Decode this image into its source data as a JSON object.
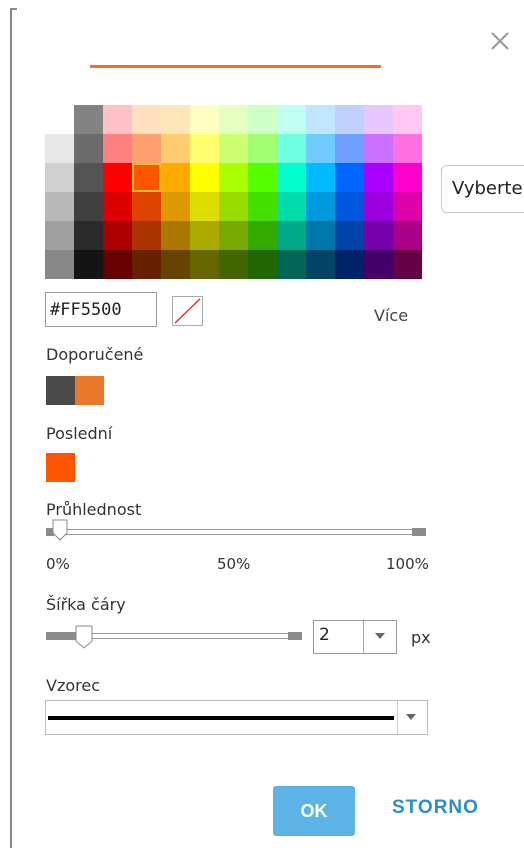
{
  "dialog": {
    "close_icon": "close-icon",
    "preview_line_color": "#f26f2b"
  },
  "palette": {
    "rows": [
      [
        "#ffffff",
        "#828282",
        "#ffc0c6",
        "#ffe0c0",
        "#ffe6b8",
        "#ffffc0",
        "#e6ffc0",
        "#d0ffc8",
        "#c0fff0",
        "#c0e6ff",
        "#c0d0ff",
        "#e6c8ff",
        "#ffc8f0"
      ],
      [
        "#e8e8e8",
        "#6c6c6c",
        "#ff8080",
        "#ffa070",
        "#ffcc70",
        "#ffff70",
        "#ccff70",
        "#a0ff70",
        "#70ffe0",
        "#70ccff",
        "#70a0ff",
        "#cc70ff",
        "#ff70e0"
      ],
      [
        "#d0d0d0",
        "#545454",
        "#ff0000",
        "#ff5500",
        "#ffaa00",
        "#ffff00",
        "#aaff00",
        "#55ff00",
        "#00ffcc",
        "#00bbff",
        "#0066ff",
        "#aa00ff",
        "#ff00cc"
      ],
      [
        "#b8b8b8",
        "#404040",
        "#dd0000",
        "#dd4400",
        "#dd9900",
        "#dddd00",
        "#99dd00",
        "#44dd00",
        "#00ddaa",
        "#0099dd",
        "#0055dd",
        "#9900dd",
        "#dd00aa"
      ],
      [
        "#a0a0a0",
        "#2a2a2a",
        "#aa0000",
        "#aa3300",
        "#aa7700",
        "#aaaa00",
        "#77aa00",
        "#33aa00",
        "#00aa88",
        "#0077aa",
        "#0044aa",
        "#7700aa",
        "#aa0088"
      ],
      [
        "#888888",
        "#141414",
        "#660000",
        "#662200",
        "#664400",
        "#666600",
        "#446600",
        "#226600",
        "#006655",
        "#004466",
        "#002266",
        "#440066",
        "#660044"
      ]
    ],
    "selected": "#ff5500"
  },
  "hex_value": "#FF5500",
  "no_color_icon": "no-color-icon",
  "more_label": "Více",
  "side_select_label": "Vyberte",
  "recommended": {
    "label": "Doporučené",
    "colors": [
      "#4a4a4a",
      "#e8782a"
    ]
  },
  "recent": {
    "label": "Poslední",
    "colors": [
      "#ff5500"
    ]
  },
  "transparency": {
    "label": "Průhlednost",
    "value": 0.0,
    "ticks": [
      "0%",
      "50%",
      "100%"
    ]
  },
  "line_width": {
    "label": "Šířka čáry",
    "value": "2",
    "unit": "px",
    "slider_fraction": 0.15
  },
  "pattern": {
    "label": "Vzorec",
    "selected": "solid"
  },
  "buttons": {
    "ok": "OK",
    "cancel": "STORNO"
  }
}
